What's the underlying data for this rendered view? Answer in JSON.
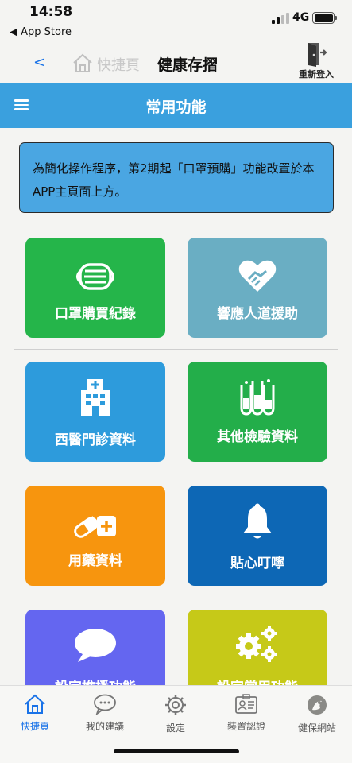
{
  "status_bar": {
    "time": "14:58",
    "back_app": "◀ App Store",
    "network": "4G"
  },
  "nav": {
    "back": "<",
    "faded_label": "快捷頁",
    "title": "健康存摺",
    "relogin_label": "重新登入"
  },
  "header_bar": {
    "title": "常用功能"
  },
  "notice": {
    "text": "為簡化操作程序，第2期起「口罩預購」功能改置於本APP主頁面上方。"
  },
  "tiles": [
    {
      "label": "口罩購買紀錄",
      "color": "#25b54a",
      "icon": "mask-icon"
    },
    {
      "label": "響應人道援助",
      "color": "#6aaec3",
      "icon": "heart-handshake-icon"
    },
    {
      "label": "西醫門診資料",
      "color": "#2d9bdc",
      "icon": "hospital-icon"
    },
    {
      "label": "其他檢驗資料",
      "color": "#23ae4a",
      "icon": "test-tubes-icon"
    },
    {
      "label": "用藥資料",
      "color": "#f7950e",
      "icon": "pill-icon"
    },
    {
      "label": "貼心叮嚀",
      "color": "#0d67b5",
      "icon": "bell-icon"
    },
    {
      "label": "設定推播功能",
      "color": "#6466f0",
      "icon": "chat-bubble-icon"
    },
    {
      "label": "設定常用功能",
      "color": "#c6c918",
      "icon": "gears-icon"
    }
  ],
  "tab_bar": {
    "items": [
      {
        "label": "快捷頁",
        "icon": "home-icon",
        "active": true
      },
      {
        "label": "我的建議",
        "icon": "chat-icon",
        "active": false
      },
      {
        "label": "設定",
        "icon": "gear-icon",
        "active": false
      },
      {
        "label": "裝置認證",
        "icon": "id-card-icon",
        "active": false
      },
      {
        "label": "健保網站",
        "icon": "website-icon",
        "active": false
      }
    ]
  },
  "colors": {
    "accent_blue": "#3aa0de",
    "active_tab": "#1a73e8"
  }
}
